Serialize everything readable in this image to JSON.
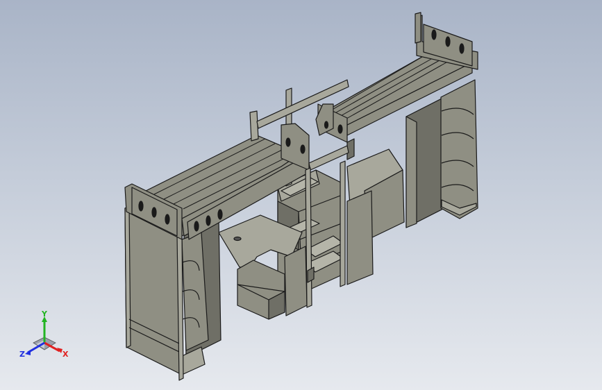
{
  "window": {
    "background_top": "#a9b4c7",
    "background_bottom": "#e6e9ee"
  },
  "model": {
    "fill": "#8f8f83",
    "fill_light": "#a8a89c",
    "fill_dark": "#6f6f66",
    "edge": "#1a1a1a"
  },
  "triad": {
    "x_label": "X",
    "y_label": "Y",
    "z_label": "Z",
    "x_color": "#e02020",
    "y_color": "#22b422",
    "z_color": "#2030e0"
  }
}
